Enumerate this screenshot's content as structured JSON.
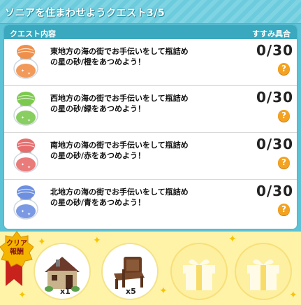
{
  "header": {
    "title": "ソニアを住まわせようクエスト3/5"
  },
  "panel": {
    "col_left": "クエスト内容",
    "col_right": "すすみ具合"
  },
  "quests": [
    {
      "text": "東地方の海の街でお手伝いをして瓶詰めの星の砂/橙をあつめよう！",
      "progress": "0/30",
      "help": "?",
      "jar_color": "#f08f4a"
    },
    {
      "text": "西地方の海の街でお手伝いをして瓶詰めの星の砂/緑をあつめよう！",
      "progress": "0/30",
      "help": "?",
      "jar_color": "#7cc94f"
    },
    {
      "text": "南地方の海の街でお手伝いをして瓶詰めの星の砂/赤をあつめよう！",
      "progress": "0/30",
      "help": "?",
      "jar_color": "#e76d6d"
    },
    {
      "text": "北地方の海の街でお手伝いをして瓶詰めの星の砂/青をあつめよう！",
      "progress": "0/30",
      "help": "?",
      "jar_color": "#6d8fe0"
    }
  ],
  "rewards": {
    "badge_label_1": "クリア",
    "badge_label_2": "報酬",
    "items": [
      {
        "icon": "house-icon",
        "count": "x1"
      },
      {
        "icon": "bench-icon",
        "count": "x5"
      },
      {
        "icon": "gift-icon"
      },
      {
        "icon": "gift-icon"
      }
    ]
  },
  "colors": {
    "accent": "#3aa8be",
    "header": "#6ccbdc",
    "help": "#f4a221",
    "reward_bg": "#fff3a8"
  }
}
